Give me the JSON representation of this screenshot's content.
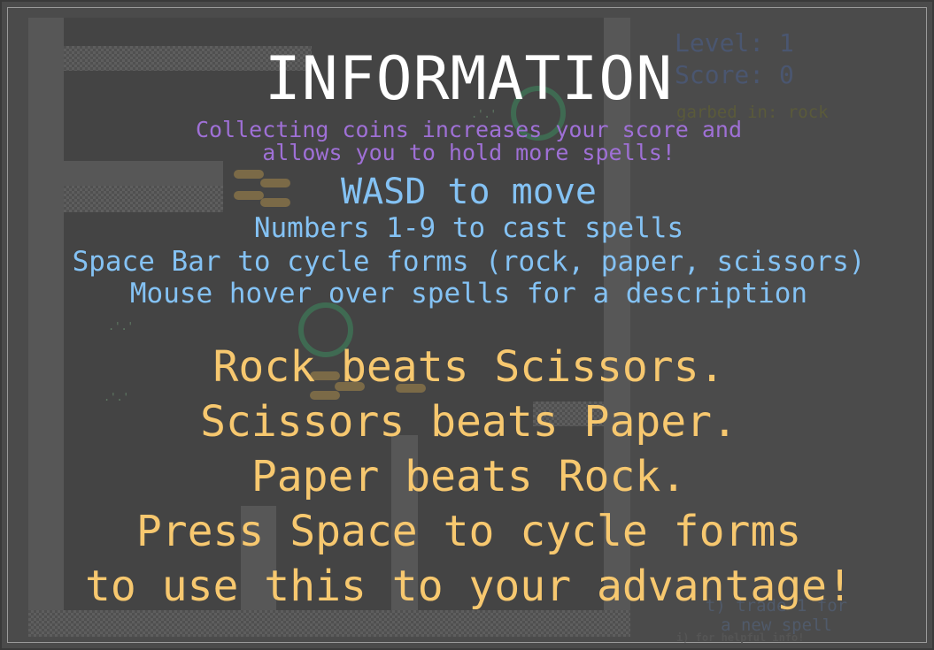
{
  "hud": {
    "level": "Level: 1",
    "score": "Score: 0",
    "garbed": "garbed in: rock",
    "trade_1": "t) trade 1 for",
    "trade_2": "a new spell",
    "info_hint": "i) for helpful info!"
  },
  "overlay": {
    "title": "INFORMATION",
    "coins_line_1": "Collecting coins increases your score and",
    "coins_line_2": "allows you to hold more spells!",
    "wasd": "WASD to move",
    "numbers": "Numbers 1-9 to cast spells",
    "space_bar": "Space Bar to cycle forms (rock, paper, scissors)",
    "mouse_hover": "Mouse hover over spells for a description",
    "rules": [
      "Rock beats Scissors.",
      "Scissors beats Paper.",
      "Paper beats Rock.",
      "Press Space to cycle forms",
      "to use this to your advantage!"
    ]
  },
  "colors": {
    "title": "#ffffff",
    "coins_text": "#9f70d6",
    "controls_text": "#84c2f4",
    "rules_text": "#f7c86f",
    "background": "#4b4b4b"
  }
}
